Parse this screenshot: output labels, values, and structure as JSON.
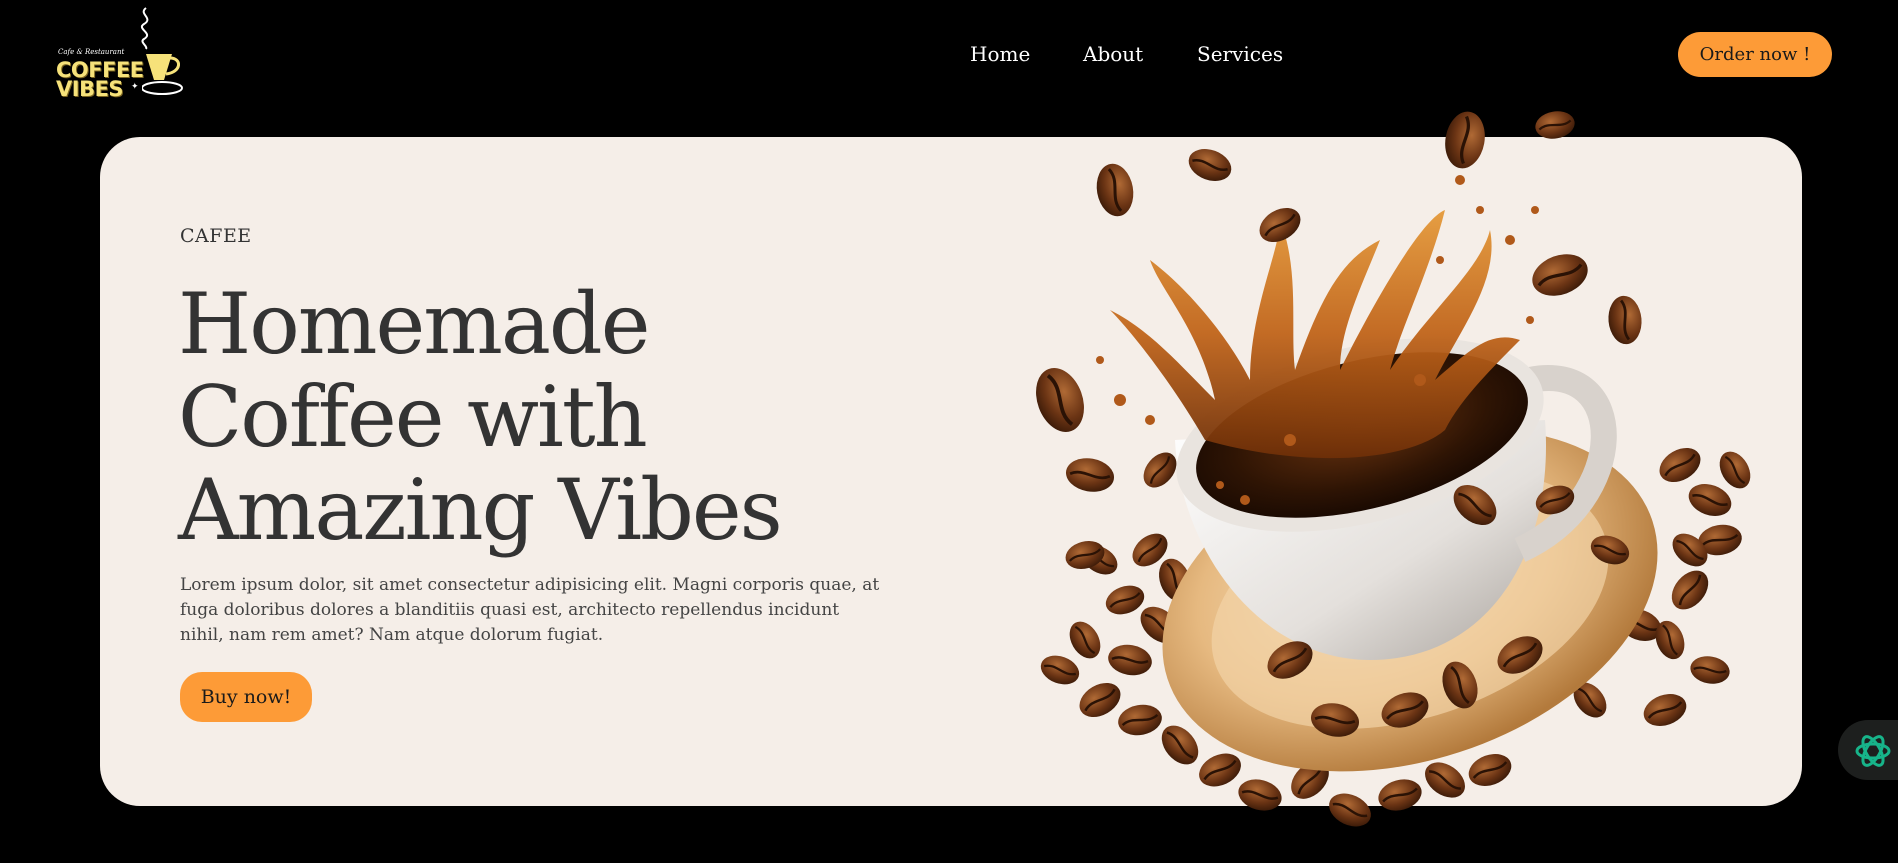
{
  "brand": {
    "tagline": "Cafe & Restaurant",
    "line1": "COFFEE",
    "line2": "VIBES",
    "color": "#f6e27a"
  },
  "nav": {
    "items": [
      "Home",
      "About",
      "Services"
    ]
  },
  "header": {
    "order_label": "Order now !"
  },
  "hero": {
    "eyebrow": "CAFEE",
    "headline_lines": [
      "Homemade",
      "Coffee with",
      "Amazing Vibes"
    ],
    "body": "Lorem ipsum dolor, sit amet consectetur adipisicing elit. Magni corporis quae, at fuga doloribus dolores a blanditiis quasi est, architecto repellendus incidunt nihil, nam rem amet? Nam atque dolorum fugiat.",
    "buy_label": "Buy now!"
  },
  "colors": {
    "accent": "#fd9b37",
    "background": "#000000",
    "card": "#f5eee8",
    "text": "#333333"
  },
  "icons": {
    "assistant": "openai-icon",
    "illustration": "coffee-cup-splash-with-beans"
  }
}
